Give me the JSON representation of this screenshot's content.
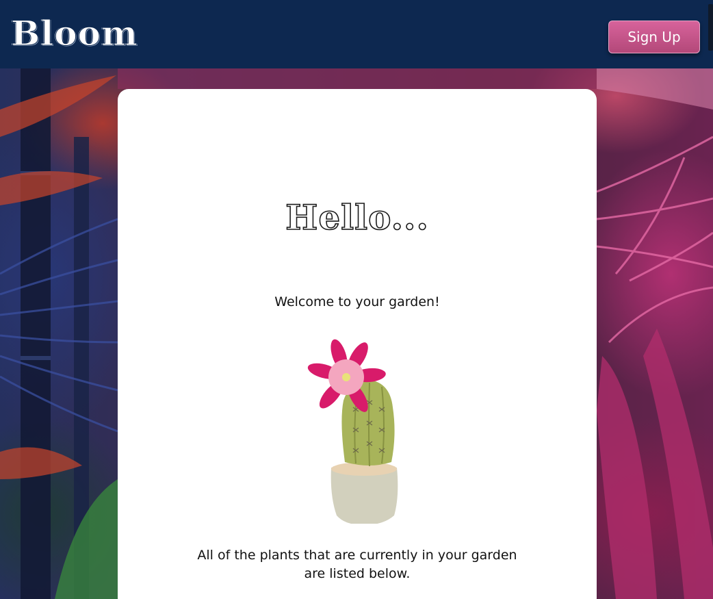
{
  "header": {
    "logo_text": "Bloom",
    "signup_label": "Sign Up",
    "background_color": "#0d2850",
    "button_color": "#c9558b"
  },
  "main": {
    "greeting": "Hello...",
    "welcome_text": "Welcome to your garden!",
    "illustration": "flowering-cactus-in-pot",
    "plants_text": "All of the plants that are currently in your garden are listed below."
  },
  "icons": {
    "cactus": "cactus-illustration-icon"
  }
}
